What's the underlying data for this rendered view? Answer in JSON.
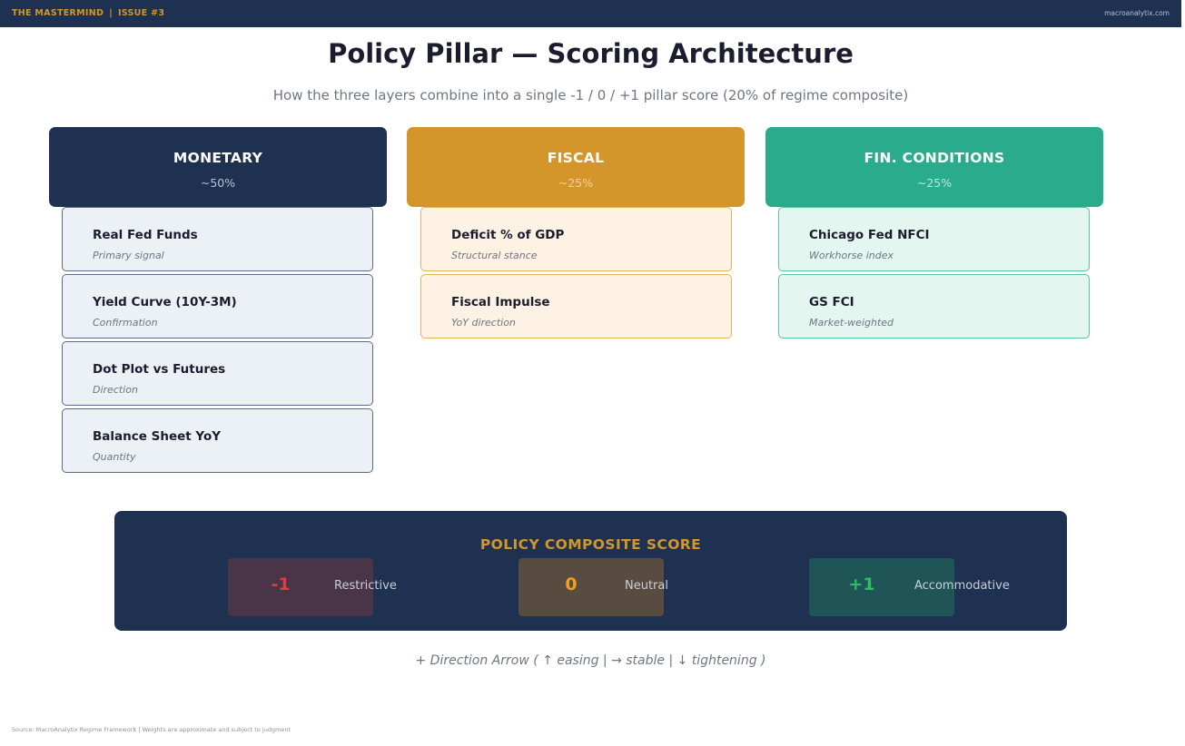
{
  "topbar": {
    "brand": "THE MASTERMIND",
    "separator": "|",
    "issue": "ISSUE #3",
    "site": "macroanalytix.com"
  },
  "title": "Policy Pillar — Scoring Architecture",
  "subtitle": "How the three layers combine into a single -1 / 0 / +1 pillar score (20% of regime composite)",
  "pillars": [
    {
      "name": "MONETARY",
      "weight": "~50%",
      "color": "#1e3150",
      "items": [
        {
          "title": "Real Fed Funds",
          "sub": "Primary signal"
        },
        {
          "title": "Yield Curve (10Y-3M)",
          "sub": "Confirmation"
        },
        {
          "title": "Dot Plot vs Futures",
          "sub": "Direction"
        },
        {
          "title": "Balance Sheet YoY",
          "sub": "Quantity"
        }
      ]
    },
    {
      "name": "FISCAL",
      "weight": "~25%",
      "color": "#d4952a",
      "items": [
        {
          "title": "Deficit % of GDP",
          "sub": "Structural stance"
        },
        {
          "title": "Fiscal Impulse",
          "sub": "YoY direction"
        }
      ]
    },
    {
      "name": "FIN. CONDITIONS",
      "weight": "~25%",
      "color": "#2aab8c",
      "items": [
        {
          "title": "Chicago Fed NFCI",
          "sub": "Workhorse index"
        },
        {
          "title": "GS FCI",
          "sub": "Market-weighted"
        }
      ]
    }
  ],
  "composite": {
    "title": "POLICY COMPOSITE SCORE",
    "scores": [
      {
        "value": "-1",
        "label": "Restrictive",
        "color": "#e03e3e"
      },
      {
        "value": "0",
        "label": "Neutral",
        "color": "#f0a020"
      },
      {
        "value": "+1",
        "label": "Accommodative",
        "color": "#2cc060"
      }
    ]
  },
  "direction_note": "+ Direction Arrow  ( ↑ easing  |  → stable  |  ↓ tightening )",
  "footer": "Source: MacroAnalytix Regime Framework  |  Weights are approximate and subject to judgment"
}
